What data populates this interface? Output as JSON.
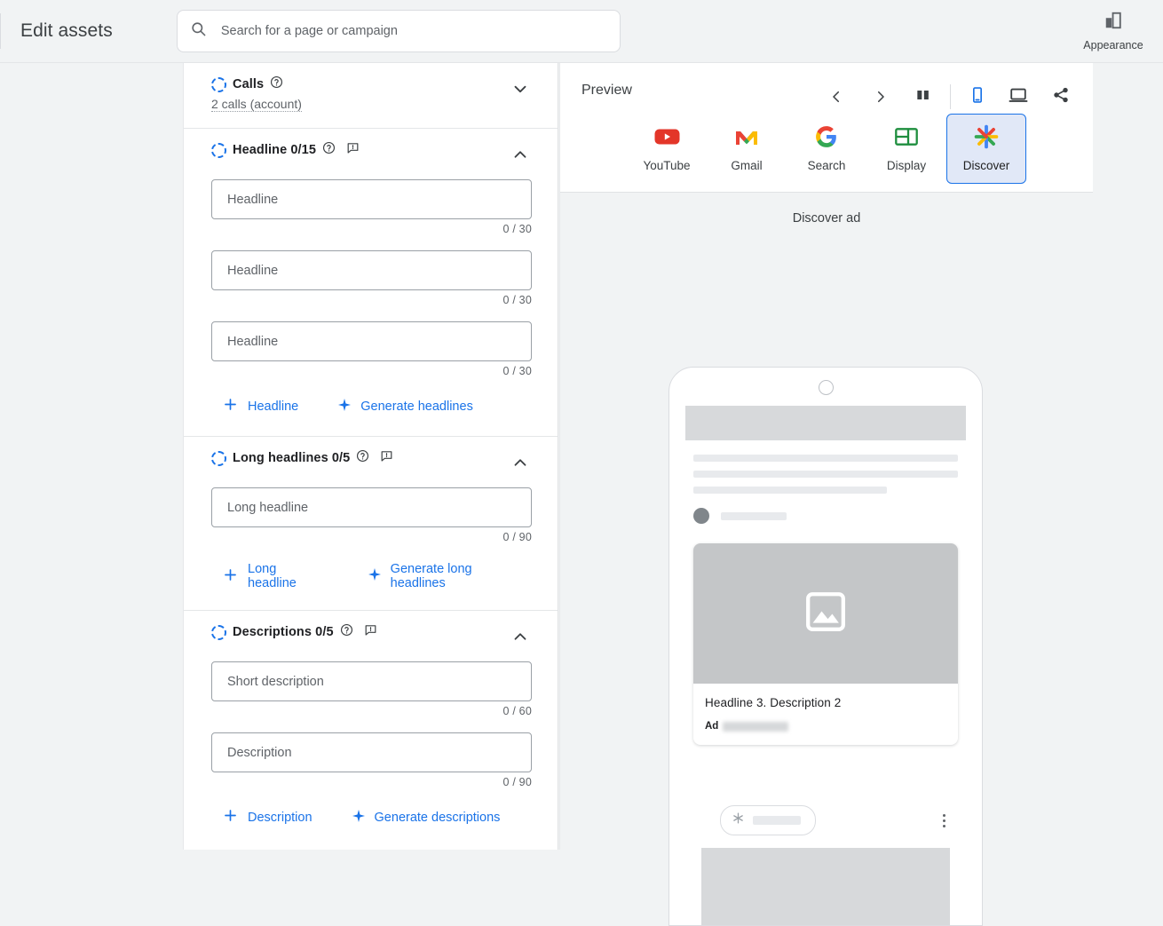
{
  "header": {
    "title": "Edit assets",
    "search": {
      "placeholder": "Search for a page or campaign",
      "value": ""
    },
    "appearance_label": "Appearance",
    "search_icon": "search-icon",
    "appearance_icon": "appearance-bars-icon"
  },
  "editor": {
    "sections": [
      {
        "id": "calls",
        "title": "Calls",
        "subtitle": "2 calls (account)",
        "has_help_icon": true,
        "has_feedback_icon": false,
        "expanded": false,
        "chevron": "chevron-down-icon",
        "fields": [],
        "actions": []
      },
      {
        "id": "headline",
        "title": "Headline 0/15",
        "subtitle": "",
        "has_help_icon": true,
        "has_feedback_icon": true,
        "expanded": true,
        "chevron": "chevron-up-icon",
        "fields": [
          {
            "placeholder": "Headline",
            "value": "",
            "counter": "0 / 30"
          },
          {
            "placeholder": "Headline",
            "value": "",
            "counter": "0 / 30"
          },
          {
            "placeholder": "Headline",
            "value": "",
            "counter": "0 / 30"
          }
        ],
        "actions": [
          {
            "icon": "plus-icon",
            "label": "Headline"
          },
          {
            "icon": "sparkle-icon",
            "label": "Generate headlines"
          }
        ]
      },
      {
        "id": "long-headlines",
        "title": "Long headlines 0/5",
        "subtitle": "",
        "has_help_icon": true,
        "has_feedback_icon": true,
        "expanded": true,
        "chevron": "chevron-up-icon",
        "fields": [
          {
            "placeholder": "Long headline",
            "value": "",
            "counter": "0 / 90"
          }
        ],
        "actions": [
          {
            "icon": "plus-icon",
            "label": "Long headline"
          },
          {
            "icon": "sparkle-icon",
            "label": "Generate long headlines"
          }
        ]
      },
      {
        "id": "descriptions",
        "title": "Descriptions 0/5",
        "subtitle": "",
        "has_help_icon": true,
        "has_feedback_icon": true,
        "expanded": true,
        "chevron": "chevron-up-icon",
        "fields": [
          {
            "placeholder": "Short description",
            "value": "",
            "counter": "0 / 60"
          },
          {
            "placeholder": "Description",
            "value": "",
            "counter": "0 / 90"
          }
        ],
        "actions": [
          {
            "icon": "plus-icon",
            "label": "Description"
          },
          {
            "icon": "sparkle-icon",
            "label": "Generate descriptions"
          }
        ]
      }
    ]
  },
  "preview": {
    "label": "Preview",
    "tools": [
      {
        "name": "previous-preview-button",
        "icon": "chevron-left-icon"
      },
      {
        "name": "next-preview-button",
        "icon": "chevron-right-icon"
      },
      {
        "name": "split-view-button",
        "icon": "split-columns-icon"
      },
      {
        "name": "mobile-view-button",
        "icon": "mobile-icon",
        "active": true
      },
      {
        "name": "desktop-view-button",
        "icon": "desktop-icon",
        "active": false
      },
      {
        "name": "share-preview-button",
        "icon": "share-icon"
      }
    ],
    "channels": [
      {
        "id": "youtube",
        "label": "YouTube",
        "icon": "youtube-icon",
        "selected": false
      },
      {
        "id": "gmail",
        "label": "Gmail",
        "icon": "gmail-icon",
        "selected": false
      },
      {
        "id": "search",
        "label": "Search",
        "icon": "google-g-icon",
        "selected": false
      },
      {
        "id": "display",
        "label": "Display",
        "icon": "display-layout-icon",
        "selected": false
      },
      {
        "id": "discover",
        "label": "Discover",
        "icon": "discover-asterisk-icon",
        "selected": true
      }
    ],
    "ad_type_label": "Discover ad",
    "mock": {
      "image_placeholder_icon": "image-placeholder-icon",
      "ad_headline": "Headline 3. Description 2",
      "ad_badge": "Ad",
      "ad_url_redacted": true,
      "pill_icon": "asterisk-icon",
      "more_icon": "more-vertical-icon"
    }
  },
  "colors": {
    "accent_blue": "#1a73e8",
    "selected_tab_bg": "#e1e8f7",
    "page_bg": "#f1f3f4",
    "text_primary": "#202124",
    "text_secondary": "#5f6368",
    "skeleton_light": "#e8eaed",
    "skeleton_dark": "#d7d9db"
  }
}
